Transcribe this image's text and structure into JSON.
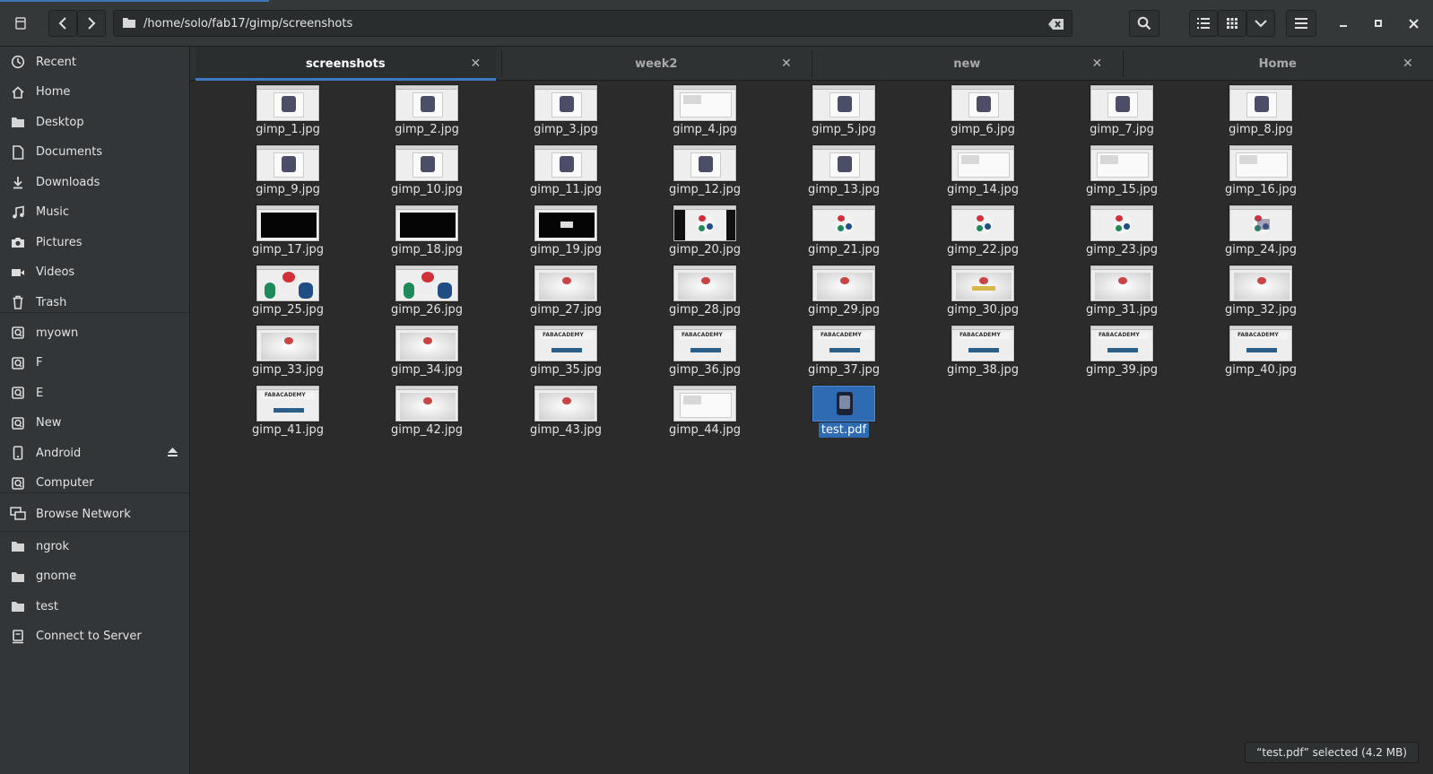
{
  "window": {
    "path": "/home/solo/fab17/gimp/screenshots"
  },
  "colors": {
    "accent": "#3e7ac1",
    "selected": "#2f6bb3",
    "background": "#2b2b2b",
    "sidebar": "#333638"
  },
  "header": {
    "icons": [
      "files-app-icon",
      "back-icon",
      "forward-icon",
      "folder-icon",
      "clear-icon",
      "search-icon",
      "list-view-icon",
      "grid-view-icon",
      "view-options-icon",
      "menu-icon",
      "minimize-icon",
      "maximize-icon",
      "close-icon"
    ]
  },
  "sidebar": {
    "places": [
      {
        "label": "Recent",
        "icon": "clock-icon"
      },
      {
        "label": "Home",
        "icon": "home-icon"
      },
      {
        "label": "Desktop",
        "icon": "folder-icon"
      },
      {
        "label": "Documents",
        "icon": "document-icon"
      },
      {
        "label": "Downloads",
        "icon": "download-icon"
      },
      {
        "label": "Music",
        "icon": "music-icon"
      },
      {
        "label": "Pictures",
        "icon": "camera-icon"
      },
      {
        "label": "Videos",
        "icon": "video-icon"
      },
      {
        "label": "Trash",
        "icon": "trash-icon"
      }
    ],
    "devices": [
      {
        "label": "myown",
        "icon": "drive-icon"
      },
      {
        "label": "F",
        "icon": "drive-icon"
      },
      {
        "label": "E",
        "icon": "drive-icon"
      },
      {
        "label": "New",
        "icon": "drive-icon"
      },
      {
        "label": "Android",
        "icon": "phone-icon",
        "eject": true
      },
      {
        "label": "Computer",
        "icon": "drive-icon"
      }
    ],
    "network": [
      {
        "label": "Browse Network",
        "icon": "network-icon"
      }
    ],
    "bookmarks": [
      {
        "label": "ngrok",
        "icon": "folder-icon"
      },
      {
        "label": "gnome",
        "icon": "folder-icon"
      },
      {
        "label": "test",
        "icon": "folder-icon"
      },
      {
        "label": "Connect to Server",
        "icon": "server-icon"
      }
    ]
  },
  "tabs": [
    {
      "label": "screenshots",
      "active": true
    },
    {
      "label": "week2",
      "active": false
    },
    {
      "label": "new",
      "active": false
    },
    {
      "label": "Home",
      "active": false
    }
  ],
  "files": [
    "gimp_1.jpg",
    "gimp_2.jpg",
    "gimp_3.jpg",
    "gimp_4.jpg",
    "gimp_5.jpg",
    "gimp_6.jpg",
    "gimp_7.jpg",
    "gimp_8.jpg",
    "gimp_9.jpg",
    "gimp_10.jpg",
    "gimp_11.jpg",
    "gimp_12.jpg",
    "gimp_13.jpg",
    "gimp_14.jpg",
    "gimp_15.jpg",
    "gimp_16.jpg",
    "gimp_17.jpg",
    "gimp_18.jpg",
    "gimp_19.jpg",
    "gimp_20.jpg",
    "gimp_21.jpg",
    "gimp_22.jpg",
    "gimp_23.jpg",
    "gimp_24.jpg",
    "gimp_25.jpg",
    "gimp_26.jpg",
    "gimp_27.jpg",
    "gimp_28.jpg",
    "gimp_29.jpg",
    "gimp_30.jpg",
    "gimp_31.jpg",
    "gimp_32.jpg",
    "gimp_33.jpg",
    "gimp_34.jpg",
    "gimp_35.jpg",
    "gimp_36.jpg",
    "gimp_37.jpg",
    "gimp_38.jpg",
    "gimp_39.jpg",
    "gimp_40.jpg",
    "gimp_41.jpg",
    "gimp_42.jpg",
    "gimp_43.jpg",
    "gimp_44.jpg",
    "test.pdf"
  ],
  "selected_file": "test.pdf",
  "status": {
    "text": "“test.pdf” selected  (4.2 MB)"
  }
}
